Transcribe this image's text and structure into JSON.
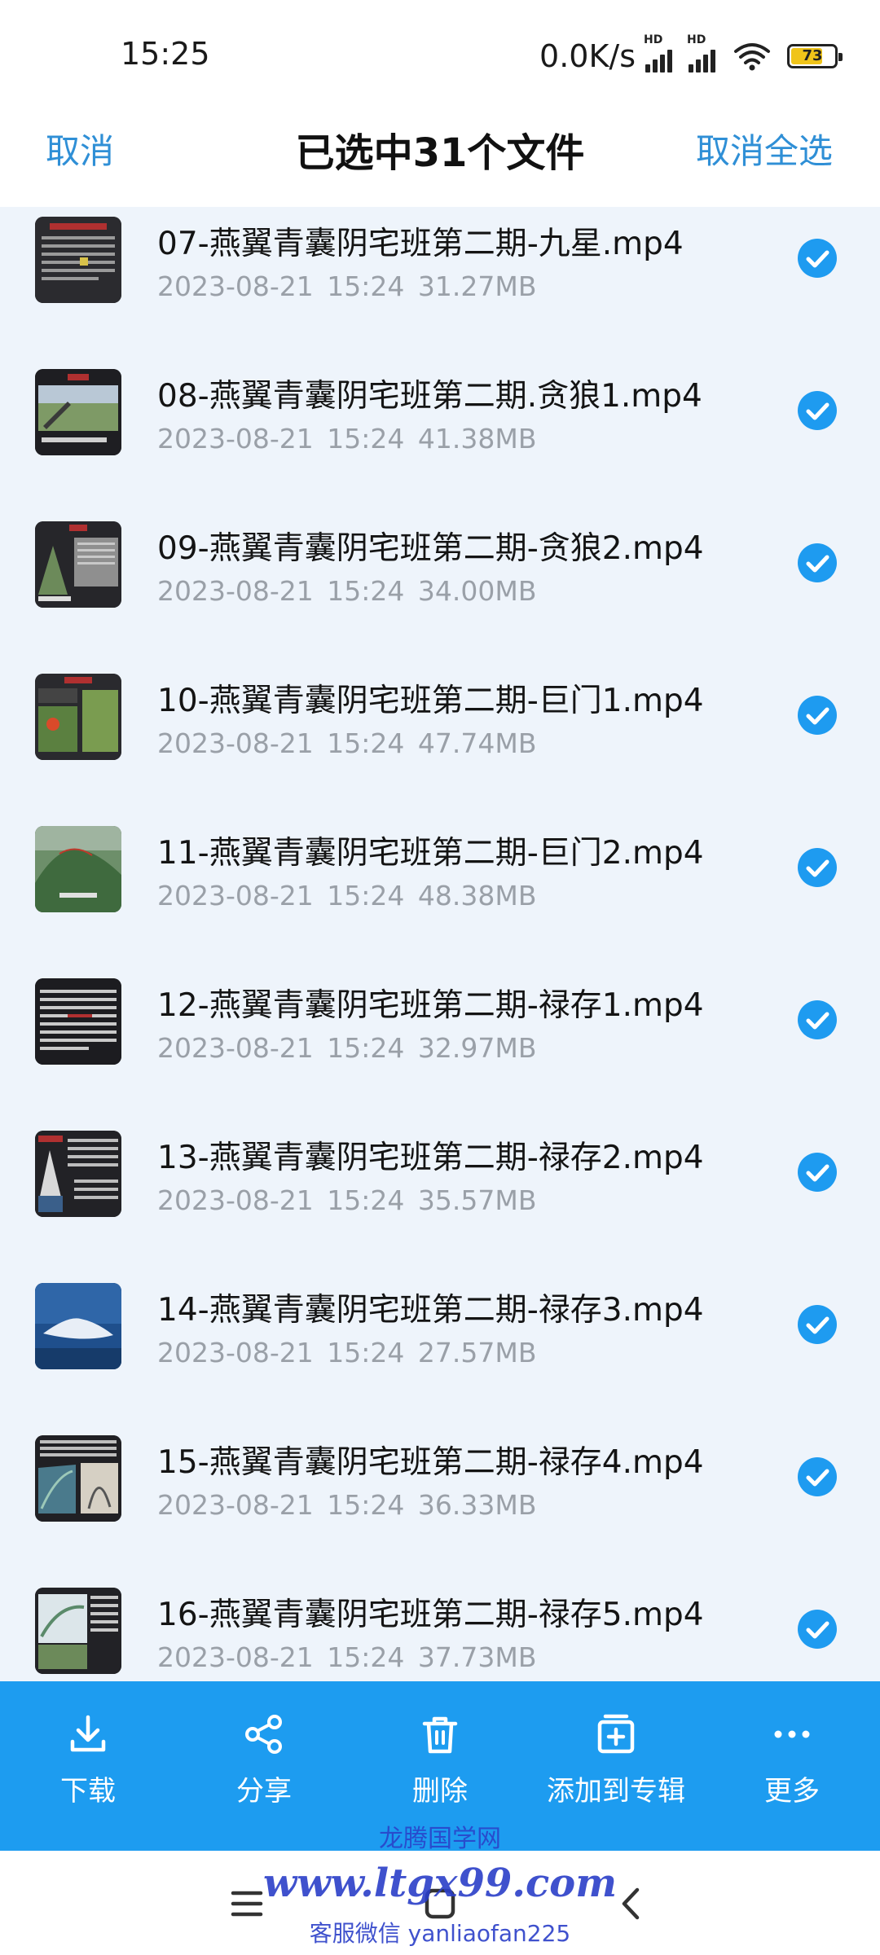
{
  "status_bar": {
    "time": "15:25",
    "net_speed": "0.0K/s",
    "sim1_label": "HD",
    "sim2_label": "HD",
    "battery": "73",
    "battery_level": 0.73
  },
  "header": {
    "cancel_label": "取消",
    "title": "已选中31个文件",
    "deselect_all_label": "取消全选"
  },
  "files": [
    {
      "name": "07-燕翼青囊阴宅班第二期-九星.mp4",
      "date": "2023-08-21",
      "time": "15:24",
      "size": "31.27MB",
      "selected": true
    },
    {
      "name": "08-燕翼青囊阴宅班第二期.贪狼1.mp4",
      "date": "2023-08-21",
      "time": "15:24",
      "size": "41.38MB",
      "selected": true
    },
    {
      "name": "09-燕翼青囊阴宅班第二期-贪狼2.mp4",
      "date": "2023-08-21",
      "time": "15:24",
      "size": "34.00MB",
      "selected": true
    },
    {
      "name": "10-燕翼青囊阴宅班第二期-巨门1.mp4",
      "date": "2023-08-21",
      "time": "15:24",
      "size": "47.74MB",
      "selected": true
    },
    {
      "name": "11-燕翼青囊阴宅班第二期-巨门2.mp4",
      "date": "2023-08-21",
      "time": "15:24",
      "size": "48.38MB",
      "selected": true
    },
    {
      "name": "12-燕翼青囊阴宅班第二期-禄存1.mp4",
      "date": "2023-08-21",
      "time": "15:24",
      "size": "32.97MB",
      "selected": true
    },
    {
      "name": "13-燕翼青囊阴宅班第二期-禄存2.mp4",
      "date": "2023-08-21",
      "time": "15:24",
      "size": "35.57MB",
      "selected": true
    },
    {
      "name": "14-燕翼青囊阴宅班第二期-禄存3.mp4",
      "date": "2023-08-21",
      "time": "15:24",
      "size": "27.57MB",
      "selected": true
    },
    {
      "name": "15-燕翼青囊阴宅班第二期-禄存4.mp4",
      "date": "2023-08-21",
      "time": "15:24",
      "size": "36.33MB",
      "selected": true
    },
    {
      "name": "16-燕翼青囊阴宅班第二期-禄存5.mp4",
      "date": "2023-08-21",
      "time": "15:24",
      "size": "37.73MB",
      "selected": true
    }
  ],
  "actions": [
    {
      "label": "下载",
      "icon": "download-icon"
    },
    {
      "label": "分享",
      "icon": "share-icon"
    },
    {
      "label": "删除",
      "icon": "trash-icon"
    },
    {
      "label": "添加到专辑",
      "icon": "add-to-album-icon"
    },
    {
      "label": "更多",
      "icon": "more-icon"
    }
  ],
  "nav": {
    "menu_icon": "menu-icon",
    "home_icon": "home-icon",
    "back_icon": "back-icon"
  },
  "watermark": {
    "site_name": "龙腾国学网",
    "url": "www.ltgx99.com",
    "contact": "客服微信 yanliaofan225"
  },
  "colors": {
    "accent": "#1d9cf0",
    "link": "#2f8fd6",
    "list_bg": "#eef4fb",
    "meta_text": "#9aa0a8"
  }
}
